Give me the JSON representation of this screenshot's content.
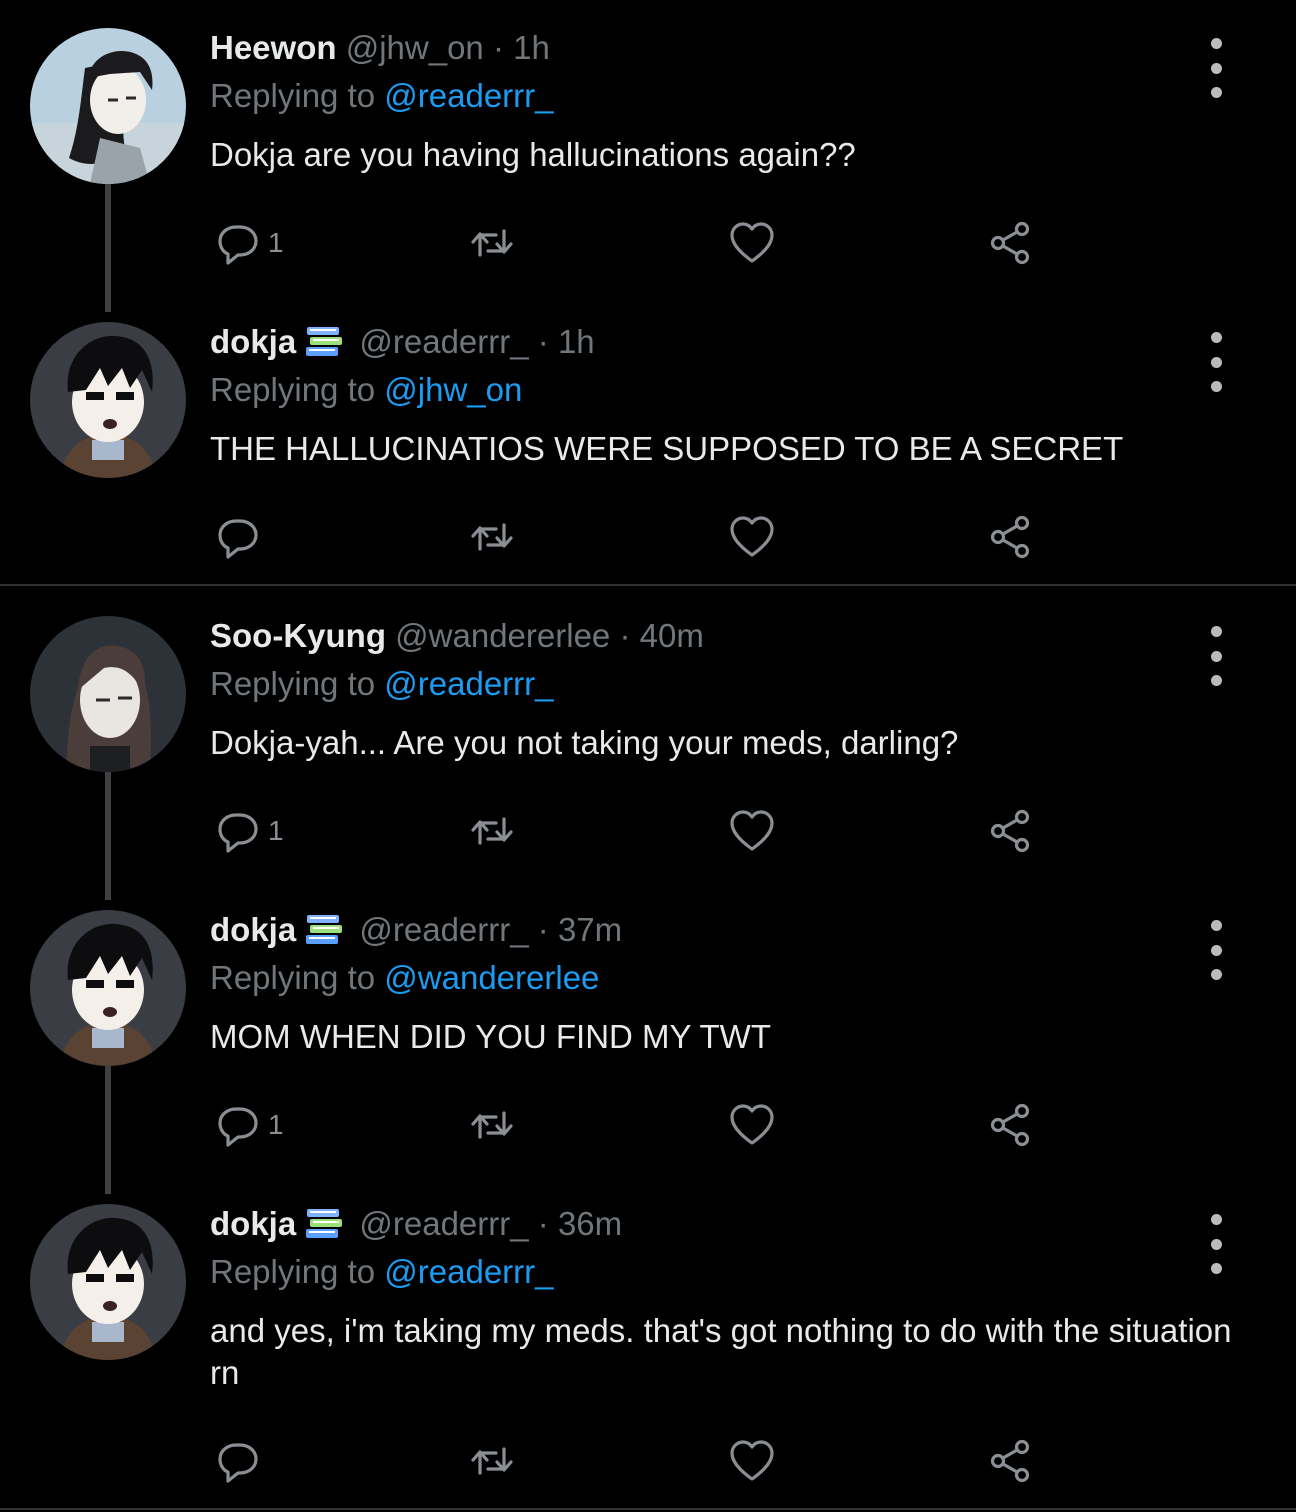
{
  "tweets": [
    {
      "name": "Heewon",
      "handle": "@jhw_on",
      "dot": "·",
      "time": "1h",
      "replying_prefix": "Replying to",
      "replying_to": "@readerrr_",
      "text": "Dokja are you having hallucinations again??",
      "reply_count": "1",
      "avatar": "heewon-avatar"
    },
    {
      "name": "dokja",
      "emoji": "books-emoji",
      "handle": "@readerrr_",
      "dot": "·",
      "time": "1h",
      "replying_prefix": "Replying to",
      "replying_to": "@jhw_on",
      "text": "THE HALLUCINATIOS WERE SUPPOSED TO BE A SECRET",
      "reply_count": "",
      "avatar": "dokja-avatar"
    },
    {
      "name": "Soo-Kyung",
      "handle": "@wandererlee",
      "dot": "·",
      "time": "40m",
      "replying_prefix": "Replying to",
      "replying_to": "@readerrr_",
      "text": "Dokja-yah... Are you not taking your meds, darling?",
      "reply_count": "1",
      "avatar": "sookyung-avatar"
    },
    {
      "name": "dokja",
      "emoji": "books-emoji",
      "handle": "@readerrr_",
      "dot": "·",
      "time": "37m",
      "replying_prefix": "Replying to",
      "replying_to": "@wandererlee",
      "text": "MOM WHEN DID YOU FIND MY TWT",
      "reply_count": "1",
      "avatar": "dokja-avatar"
    },
    {
      "name": "dokja",
      "emoji": "books-emoji",
      "handle": "@readerrr_",
      "dot": "·",
      "time": "36m",
      "replying_prefix": "Replying to",
      "replying_to": "@readerrr_",
      "text": "and yes, i'm taking my meds. that's got nothing to do with the situation rn",
      "reply_count": "",
      "avatar": "dokja-avatar"
    }
  ],
  "colors": {
    "background": "#000000",
    "text": "#e7e9ea",
    "secondary": "#71767b",
    "mention": "#1d9bf0",
    "thread_line": "#3e4144"
  },
  "icons": [
    "reply-icon",
    "retweet-icon",
    "like-icon",
    "share-icon",
    "more-icon"
  ]
}
